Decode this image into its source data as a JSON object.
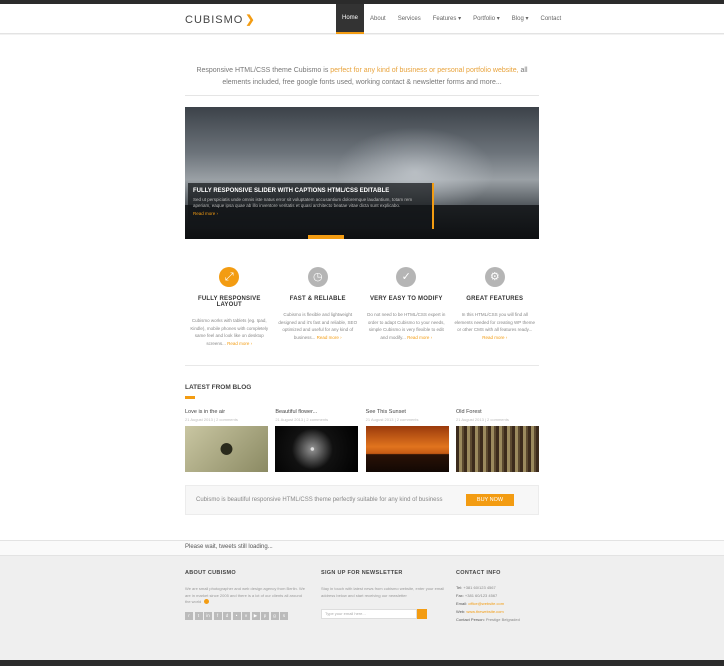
{
  "header": {
    "logo": "CUBISMO",
    "logo_mark": "❯",
    "nav": [
      "Home",
      "About",
      "Services",
      "Features",
      "Portfolio",
      "Blog",
      "Contact"
    ]
  },
  "intro": {
    "before": "Responsive HTML/CSS theme Cubismo is ",
    "highlight": "perfect for any kind of business or personal portfolio website,",
    "after": " all elements included, free google fonts used, working contact & newsletter forms and more..."
  },
  "slider": {
    "title": "FULLY RESPONSIVE SLIDER WITH CAPTIONS HTML/CSS EDITABLE",
    "desc": "Sed ut perspiciatis unde omnis iste natus error sit voluptatem accusantium doloremque laudantium, totam rem aperiam, eaque ipsa quae ab illo inventore veritatis et quasi architecto beatae vitae dicta sunt explicabo.",
    "more": "Read more ›"
  },
  "features": [
    {
      "title": "FULLY RESPONSIVE LAYOUT",
      "desc": "Cubismo works with tablets (eg. Ipad, Kindle), mobile phones with completely same feel and look like on desktop screens...",
      "more": "Read more ›",
      "icon": "arrows-icon",
      "color": "#f39c12"
    },
    {
      "title": "FAST & RELIABLE",
      "desc": "Cubismo is flexible and lightweight designed and it's fast and reliable, SEO optimized and useful for any kind of business...",
      "more": "Read more ›",
      "icon": "clock-icon",
      "color": "#b5b5b5"
    },
    {
      "title": "VERY EASY TO MODIFY",
      "desc": "Do not need to be HTML/CSS expert in order to adapt Cubismo to your needs, simple Cubismo is very flexible to edit and modify...",
      "more": "Read more ›",
      "icon": "check-icon",
      "color": "#b5b5b5"
    },
    {
      "title": "GREAT FEATURES",
      "desc": "In this HTML/CSS you will find all elements needed for creating WP theme or other CMS with all features ready...",
      "more": "Read more ›",
      "icon": "gear-icon",
      "color": "#b5b5b5"
    }
  ],
  "blog": {
    "title": "LATEST FROM BLOG",
    "posts": [
      {
        "title": "Love is in the air",
        "meta": "21 August 2013 | 2 comments"
      },
      {
        "title": "Beautiful flower...",
        "meta": "21 August 2013 | 2 comments"
      },
      {
        "title": "See This Sunset",
        "meta": "21 August 2013 | 2 comments"
      },
      {
        "title": "Old Forest",
        "meta": "21 August 2013 | 2 comments"
      }
    ]
  },
  "cta": {
    "text": "Cubismo is beautiful responsive HTML/CSS theme perfectly suitable for any kind of business",
    "button": "BUY NOW"
  },
  "tweets": "Please wait, tweets still loading...",
  "footer": {
    "about_title": "ABOUT CUBISMO",
    "about_text": "We are small photographer and web design agency from Berlin. We are in market since 2005 and there is a lot of our clients all around the world",
    "newsletter_title": "SIGN UP FOR NEWSLETTER",
    "newsletter_text": "Stay in touch with latest news from cubismo website, enter your email address below and start receiving our newsletter",
    "newsletter_placeholder": "Type your email here...",
    "contact_title": "CONTACT INFO",
    "contact": [
      {
        "label": "Tel:",
        "value": "+381 60/123 4567"
      },
      {
        "label": "Fax:",
        "value": "+381 60/123 4567"
      },
      {
        "label": "Email:",
        "value": "office@website.com"
      },
      {
        "label": "Web:",
        "value": "www.thewebsite.com"
      },
      {
        "label": "Contact Person:",
        "value": "Prestige Belgraded"
      }
    ]
  }
}
